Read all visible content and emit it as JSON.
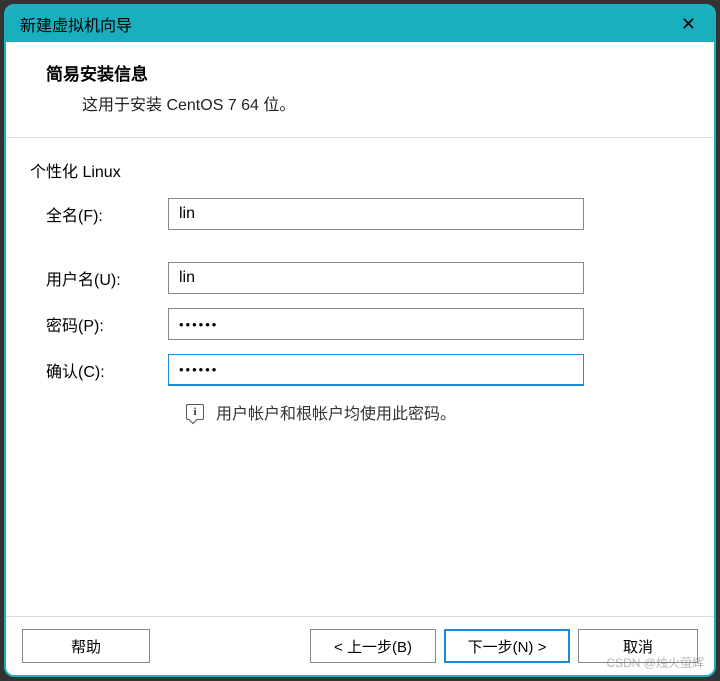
{
  "window": {
    "title": "新建虚拟机向导"
  },
  "header": {
    "title": "简易安装信息",
    "subtitle": "这用于安装 CentOS 7 64 位。"
  },
  "section": {
    "label": "个性化 Linux"
  },
  "form": {
    "fullname_label": "全名(F):",
    "fullname_value": "lin",
    "username_label": "用户名(U):",
    "username_value": "lin",
    "password_label": "密码(P):",
    "password_value": "••••••",
    "confirm_label": "确认(C):",
    "confirm_value": "••••••"
  },
  "hint": {
    "text": "用户帐户和根帐户均使用此密码。"
  },
  "footer": {
    "help": "帮助",
    "back": "< 上一步(B)",
    "next": "下一步(N) >",
    "cancel": "取消"
  },
  "watermark": "CSDN @烛火萤辉"
}
